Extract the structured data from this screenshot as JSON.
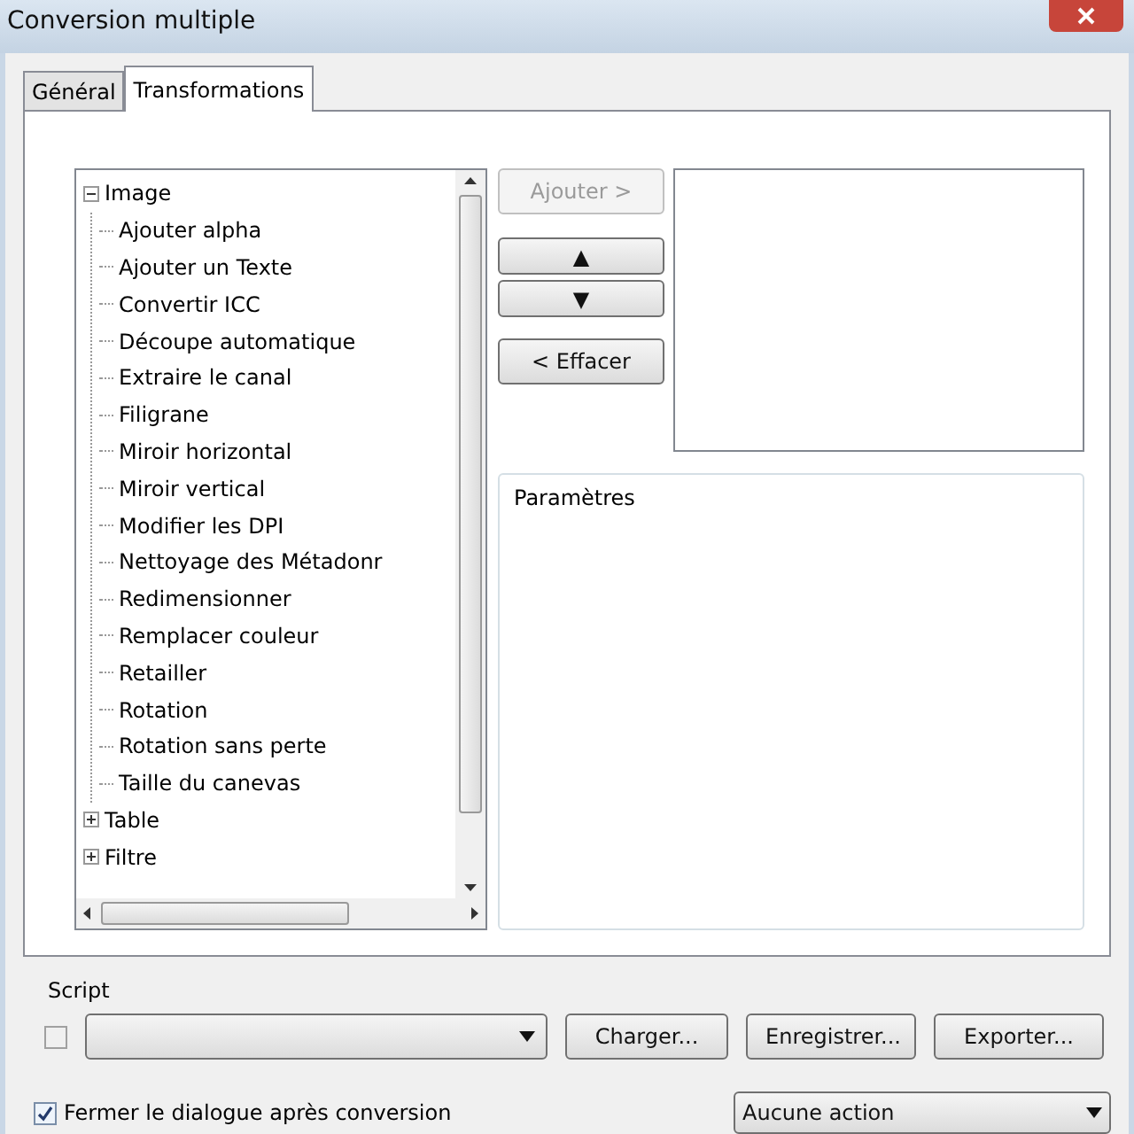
{
  "window": {
    "title": "Conversion multiple"
  },
  "tabs": [
    {
      "label": "Général",
      "selected": false
    },
    {
      "label": "Transformations",
      "selected": true
    }
  ],
  "tree": [
    {
      "label": "Image",
      "expanded": true,
      "children": [
        {
          "label": "Ajouter alpha"
        },
        {
          "label": "Ajouter un Texte"
        },
        {
          "label": "Convertir ICC"
        },
        {
          "label": "Découpe automatique"
        },
        {
          "label": "Extraire le canal"
        },
        {
          "label": "Filigrane"
        },
        {
          "label": "Miroir horizontal"
        },
        {
          "label": "Miroir vertical"
        },
        {
          "label": "Modifier les DPI"
        },
        {
          "label": "Nettoyage des Métadonr"
        },
        {
          "label": "Redimensionner"
        },
        {
          "label": "Remplacer couleur"
        },
        {
          "label": "Retailler"
        },
        {
          "label": "Rotation"
        },
        {
          "label": "Rotation sans perte"
        },
        {
          "label": "Taille du canevas"
        }
      ]
    },
    {
      "label": "Table",
      "expanded": false
    },
    {
      "label": "Filtre",
      "expanded": false
    }
  ],
  "add_button": {
    "label": "Ajouter >",
    "disabled": true
  },
  "move_buttons": [
    {
      "label": "▲"
    },
    {
      "label": "▼"
    }
  ],
  "clear_button": {
    "label": "< Effacer"
  },
  "parameters": {
    "title": "Paramètres"
  },
  "script": {
    "label": "Script",
    "checked": false,
    "buttons": [
      "Charger...",
      "Enregistrer...",
      "Exporter..."
    ]
  },
  "close_after": {
    "label": "Fermer le dialogue après conversion",
    "checked": true
  },
  "action_select": {
    "value": "Aucune action"
  }
}
